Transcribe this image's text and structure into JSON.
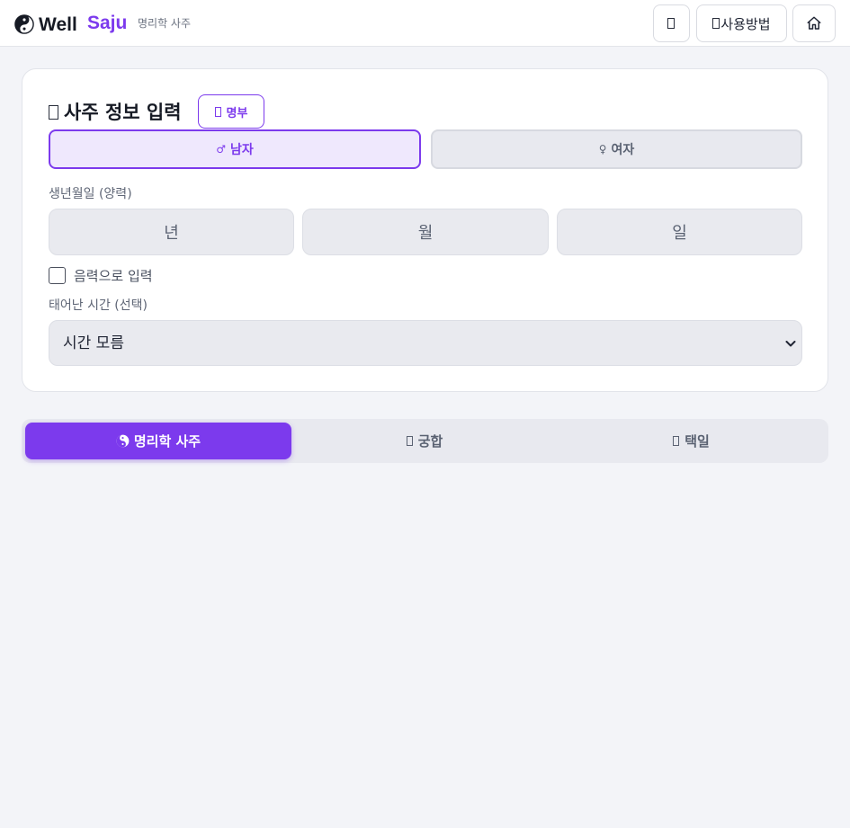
{
  "header": {
    "logo_icon": "yin-yang-icon",
    "brand_well": "Well",
    "brand_saju": "Saju",
    "brand_sub": "명리학 사주",
    "theme_button_icon": "theme-toggle-icon",
    "guide_label": "사용방법",
    "home_icon": "home-icon"
  },
  "form": {
    "title": "사주 정보 입력",
    "myeongbu_label": "명부",
    "gender": {
      "male_symbol": "♂",
      "male_label": "남자",
      "female_symbol": "♀",
      "female_label": "여자",
      "selected": "male"
    },
    "birth_label": "생년월일 (양력)",
    "year_placeholder": "년",
    "month_placeholder": "월",
    "day_placeholder": "일",
    "lunar_label": "음력으로 입력",
    "lunar_checked": false,
    "time_label": "태어난 시간 (선택)",
    "time_value": "시간 모름"
  },
  "tabs": [
    {
      "label": "명리학 사주",
      "icon": "yin-yang-icon",
      "active": true
    },
    {
      "label": "궁합",
      "icon": "couple-icon",
      "active": false
    },
    {
      "label": "택일",
      "icon": "calendar-icon",
      "active": false
    }
  ],
  "colors": {
    "accent": "#7c3aed",
    "background": "#f3f4f8",
    "input_bg": "#e9eaef"
  }
}
